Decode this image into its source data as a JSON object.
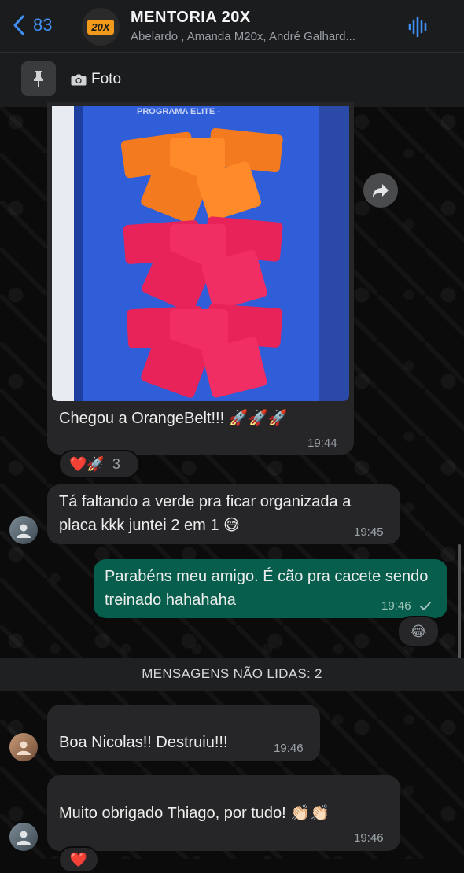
{
  "header": {
    "back_count": "83",
    "group_logo": "20X",
    "title": "MENTORIA 20X",
    "subtitle": "Abelardo , Amanda M20x, André Galhard..."
  },
  "pinned": {
    "label": "Foto"
  },
  "messages": [
    {
      "text": "Chegou a OrangeBelt!!! 🚀🚀🚀",
      "time": "19:44"
    },
    {
      "text": "Tá faltando a verde pra ficar organizada a placa kkk juntei 2 em 1 😅",
      "time": "19:45"
    },
    {
      "text": "Parabéns meu amigo. É cão pra cacete sendo treinado hahahaha",
      "time": "19:46"
    },
    {
      "text": "Boa Nicolas!! Destruiu!!!",
      "time": "19:46"
    },
    {
      "text": "Muito obrigado Thiago, por tudo! 👏🏻👏🏻",
      "time": "19:46"
    }
  ],
  "reactions": {
    "photo": {
      "emojis": "❤️🚀",
      "count": "3"
    },
    "outgoing": {
      "emojis": "😂"
    },
    "last": {
      "emojis": "❤️"
    }
  },
  "unread_banner": "MENSAGENS NÃO LIDAS: 2",
  "photo_caption_sign": "PROGRAMA ELITE - ",
  "colors": {
    "accent_blue": "#3f8ff5",
    "outgoing_bubble": "#075e4d",
    "incoming_bubble": "#262628",
    "read_check": "#53bdeb"
  },
  "icons": [
    "back-chevron-icon",
    "audio-wave-icon",
    "pin-icon",
    "camera-icon",
    "forward-icon",
    "checkmark-icon"
  ]
}
